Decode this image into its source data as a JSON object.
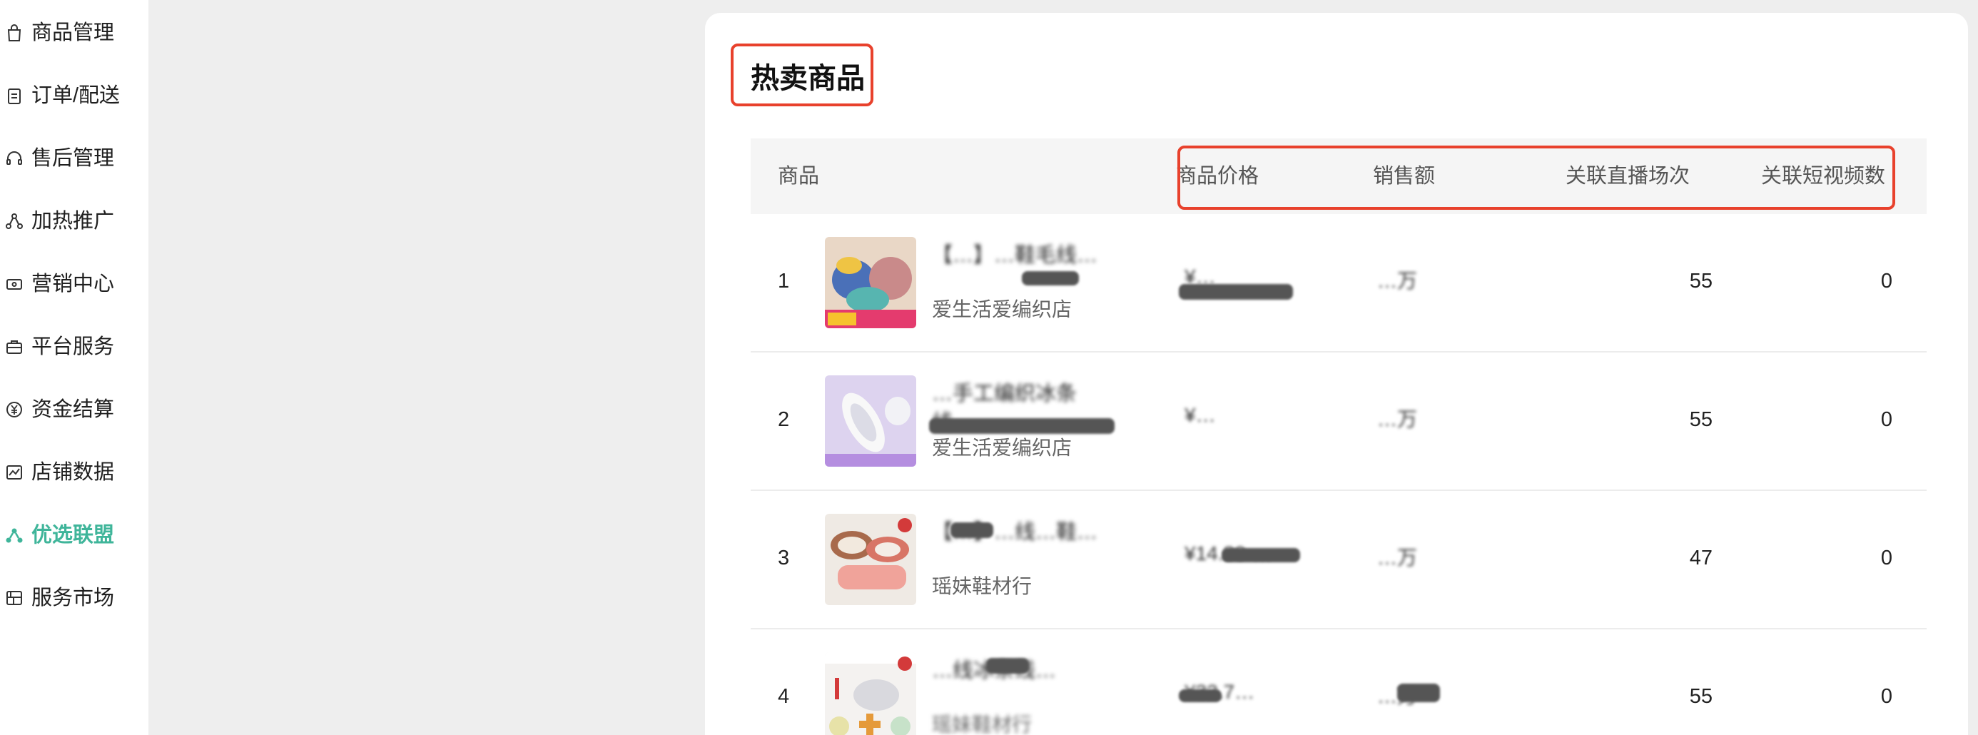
{
  "sidebar": {
    "items": [
      {
        "label": "商品管理",
        "icon": "bag-icon",
        "active": false
      },
      {
        "label": "订单/配送",
        "icon": "clipboard-icon",
        "active": false
      },
      {
        "label": "售后管理",
        "icon": "headset-icon",
        "active": false
      },
      {
        "label": "加热推广",
        "icon": "share-nodes-icon",
        "active": false
      },
      {
        "label": "营销中心",
        "icon": "ticket-icon",
        "active": false
      },
      {
        "label": "平台服务",
        "icon": "briefcase-icon",
        "active": false
      },
      {
        "label": "资金结算",
        "icon": "yen-coin-icon",
        "active": false
      },
      {
        "label": "店铺数据",
        "icon": "chart-icon",
        "active": false
      },
      {
        "label": "优选联盟",
        "icon": "alliance-icon",
        "active": true
      },
      {
        "label": "服务市场",
        "icon": "market-icon",
        "active": false
      }
    ],
    "accent_color": "#3fb59a"
  },
  "panel": {
    "title": "热卖商品",
    "highlight_color": "#e8412c"
  },
  "table": {
    "headers": {
      "product": "商品",
      "price": "商品价格",
      "sales": "销售额",
      "live_sessions": "关联直播场次",
      "short_videos": "关联短视频数"
    },
    "rows": [
      {
        "rank": "1",
        "name": "【…】…鞋毛线…",
        "shop": "爱生活爱编织店",
        "price": "¥…",
        "sales": "…万",
        "live_sessions": "55",
        "short_videos": "0"
      },
      {
        "rank": "2",
        "name": "…手工编织冰条线…",
        "shop": "爱生活爱编织店",
        "price": "¥…",
        "sales": "…万",
        "live_sessions": "55",
        "short_videos": "0"
      },
      {
        "rank": "3",
        "name": "【…】…线…鞋…",
        "shop": "瑶妹鞋材行",
        "price": "¥14.30-…",
        "sales": "…万",
        "live_sessions": "47",
        "short_videos": "0"
      },
      {
        "rank": "4",
        "name": "…线冰条线…",
        "shop": "瑶妹鞋材行",
        "price": "¥32.7…",
        "sales": "…万",
        "live_sessions": "55",
        "short_videos": "0"
      }
    ]
  }
}
